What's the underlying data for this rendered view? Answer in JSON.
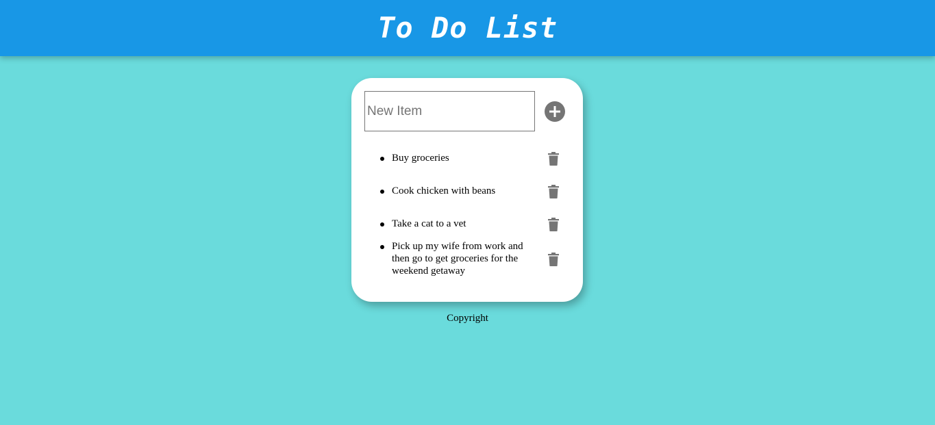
{
  "header": {
    "title": "To Do List"
  },
  "new_item": {
    "placeholder": "New Item",
    "value": ""
  },
  "add_button": {
    "icon": "plus-circle-icon"
  },
  "items": [
    {
      "text": "Buy groceries",
      "delete_icon": "trash-icon"
    },
    {
      "text": "Cook chicken with beans",
      "delete_icon": "trash-icon"
    },
    {
      "text": "Take a cat to a vet",
      "delete_icon": "trash-icon"
    },
    {
      "text": "Pick up my wife from work and then go to get groceries for the weekend getaway",
      "delete_icon": "trash-icon"
    }
  ],
  "footer": {
    "text": "Copyright"
  },
  "colors": {
    "background": "#6adbdc",
    "header": "#1897e6",
    "icon": "#757575",
    "card": "#ffffff"
  }
}
